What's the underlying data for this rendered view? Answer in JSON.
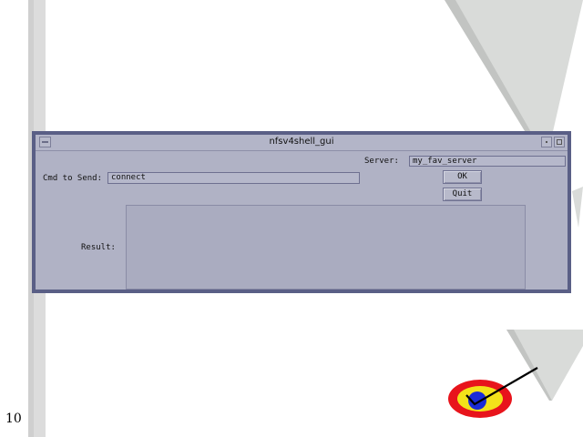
{
  "page": {
    "number": "10"
  },
  "window": {
    "title": "nfsv4shell_gui",
    "server_label": "Server:",
    "server_value": "my_fav_server",
    "cmd_label": "Cmd to Send:",
    "cmd_value": "connect",
    "ok_label": "OK",
    "quit_label": "Quit",
    "result_label": "Result:",
    "result_value": ""
  },
  "colors": {
    "window_border": "#5a5f86",
    "window_bg": "#b0b2c5",
    "triangle_gray": "#d9dbd9",
    "logo_red": "#e8141c",
    "logo_yellow": "#f3e21a",
    "logo_blue": "#1a2bd6"
  }
}
